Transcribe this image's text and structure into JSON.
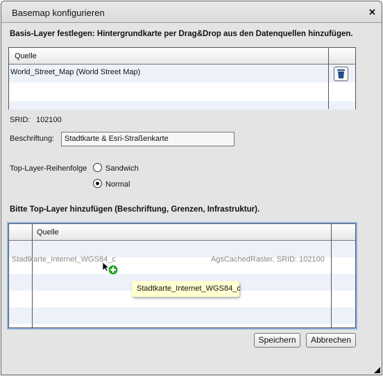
{
  "dialog": {
    "title": "Basemap konfigurieren",
    "close_icon": "close-icon"
  },
  "base_layer": {
    "heading": "Basis-Layer festlegen: Hintergrundkarte per Drag&Drop aus den Datenquellen hinzufügen.",
    "column_header": "Quelle",
    "rows": [
      {
        "source": "World_Street_Map (World Street Map)"
      }
    ],
    "delete_icon": "trash-icon"
  },
  "srid": {
    "label": "SRID:",
    "value": "102100"
  },
  "caption": {
    "label": "Beschriftung:",
    "value": "Stadtkarte & Esri-Straßenkarte"
  },
  "order": {
    "label": "Top-Layer-Reihenfolge",
    "options": [
      {
        "label": "Sandwich",
        "selected": false
      },
      {
        "label": "Normal",
        "selected": true
      }
    ]
  },
  "top_layer": {
    "heading": "Bitte Top-Layer hinzufügen (Beschriftung, Grenzen, Infrastruktur).",
    "column_header": "Quelle",
    "drag_item": {
      "name": "Stadtkarte_Internet_WGS84_c",
      "info": "AgsCachedRaster, SRID: 102100"
    },
    "tooltip": "Stadtkarte_Internet_WGS84_c"
  },
  "buttons": {
    "save": "Speichern",
    "cancel": "Abbrechen"
  },
  "colors": {
    "row_alt": "#edf2fa",
    "drop_target_border": "#8db2e3",
    "add_icon": "#22a022",
    "trash": "#1d4f8a"
  }
}
